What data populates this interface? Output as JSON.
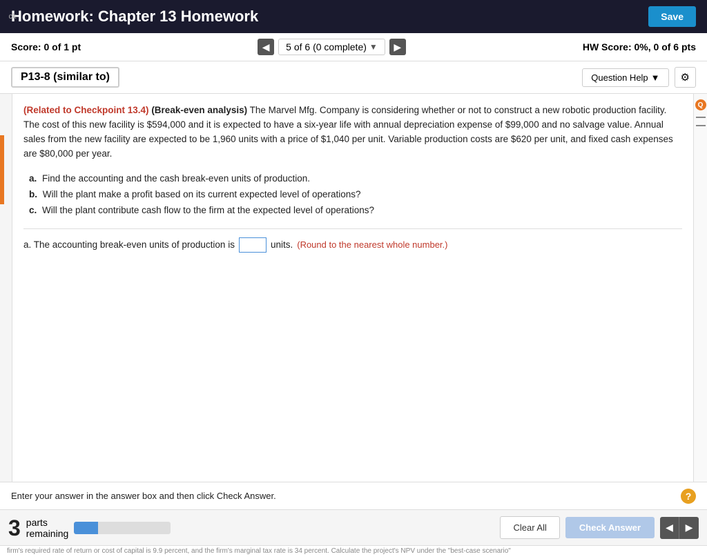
{
  "header": {
    "title": "Homework: Chapter 13 Homework",
    "save_label": "Save",
    "back_label": "ck"
  },
  "score_bar": {
    "score_label": "Score:",
    "score_value": "0 of 1 pt",
    "nav_page": "5 of 6 (0 complete)",
    "hw_score_label": "HW Score:",
    "hw_score_value": "0%, 0 of 6 pts"
  },
  "question_header": {
    "question_id": "P13-8 (similar to)",
    "help_label": "Question Help",
    "gear_symbol": "⚙"
  },
  "problem": {
    "related_label": "(Related to Checkpoint 13.4)",
    "type_label": "(Break-even analysis)",
    "intro_text": " The Marvel Mfg. Company is considering whether or not to construct a new robotic production facility.  The cost of this new facility is $594,000 and it is expected to have a six-year life with annual depreciation expense of $99,000 and no salvage value.  Annual sales from the new facility are expected to be 1,960 units with a price of $1,040 per unit.  Variable production costs are $620 per unit, and fixed cash expenses are $80,000 per year.",
    "sub_questions": [
      {
        "letter": "a.",
        "text": "Find the accounting and the cash break-even units of production."
      },
      {
        "letter": "b.",
        "text": "Will the plant make a profit based on its current expected level of operations?"
      },
      {
        "letter": "c.",
        "text": "Will the plant contribute cash flow to the firm at the expected level of operations?"
      }
    ],
    "answer_line": {
      "prefix": "a.  The accounting break-even units of production is",
      "suffix": "units.",
      "round_note": "(Round to the nearest whole number.)"
    }
  },
  "hint_bar": {
    "hint_text": "Enter your answer in the answer box and then click Check Answer.",
    "hint_icon": "?"
  },
  "action_bar": {
    "parts_number": "3",
    "parts_line1": "parts",
    "parts_line2": "remaining",
    "clear_all_label": "Clear All",
    "check_answer_label": "Check Answer",
    "nav_prev": "◄",
    "nav_next": "►"
  },
  "footer": {
    "text": "firm's required rate of return or cost of capital is 9.9 percent, and the firm's marginal tax rate is 34 percent.  Calculate the project's NPV under the \"best-case scenario\""
  }
}
